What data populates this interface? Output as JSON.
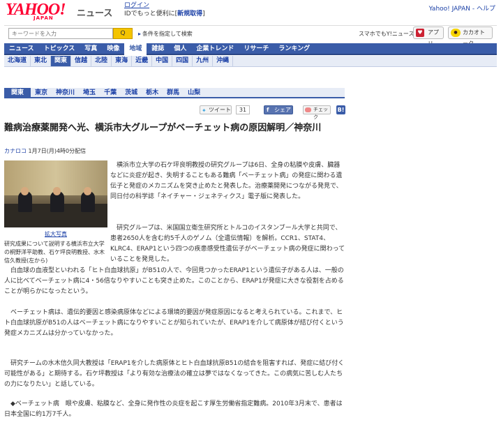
{
  "header": {
    "logo_text": "YAHOO!",
    "logo_sub": "JAPAN",
    "service": "ニュース",
    "login_link": "ログイン",
    "login_text": "IDでもっと便利に[",
    "new_register": "新規取得",
    "login_close": "]",
    "right_link": "Yahoo! JAPAN - ヘルプ"
  },
  "search": {
    "placeholder": "キーワードを入力",
    "button_icon": "search-icon",
    "button_label": "Q",
    "condition_link": "条件を指定して検索",
    "smartphone_label": "スマホでもY!ニュース",
    "app_label": "アプリ",
    "kakao_label": "カカオトーク"
  },
  "main_nav": [
    "ニュース",
    "トピックス",
    "写真",
    "映像",
    "地域",
    "雑誌",
    "個人",
    "企業トレンド",
    "リサーチ",
    "ランキング"
  ],
  "main_nav_active": "地域",
  "sub_nav": [
    "北海道",
    "東北",
    "関東",
    "信越",
    "北陸",
    "東海",
    "近畿",
    "中国",
    "四国",
    "九州",
    "沖縄"
  ],
  "sub_nav_active": "関東",
  "region_nav": [
    "関東",
    "東京",
    "神奈川",
    "埼玉",
    "千葉",
    "茨城",
    "栃木",
    "群馬",
    "山梨"
  ],
  "region_nav_active": "関東",
  "social": {
    "tweet_label": "ツイート",
    "tweet_count": "31",
    "share_label": "シェア",
    "check_label": "チェック",
    "hatena_label": "B!"
  },
  "article": {
    "title": "難病治療薬開発へ光、横浜市大グループがベーチェット病の原因解明／神奈川",
    "source": "カナロコ",
    "date": "1月7日(月)4時0分配信",
    "photo_link": "拡大写真",
    "photo_caption": "研究成果について説明する横浜市立大学の桐野洋平助教、石ケ坪良明教授、水木信久教授(左から)",
    "lead": "横浜市立大学の石ケ坪良明教授の研究グループは6日、全身の粘膜や皮膚、臓器などに炎症が起き、失明することもある難病「ベーチェット病」の発症に関わる遺伝子と発症のメカニズムを突き止めたと発表した。治療薬開発につながる発見で、同日付の科学誌「ネイチャー・ジェネティクス」電子版に発表した。",
    "para2": "研究グループは、米国国立衛生研究所とトルコのイスタンブール大学と共同で、患者2650人を含む約5千人のゲノム（全遺伝情報）を解析。CCR1、STAT4、KLRC4、ERAP1という四つの疾患感受性遺伝子がベーチェット病の発症に関わっていることを発見した。",
    "para3": "白血球の血液型といわれる「ヒト白血球抗原」がB51の人で、今回見つかったERAP1という遺伝子がある人は、一般の人に比べてベーチェット病に4・56倍なりやすいことも突き止めた。このことから、ERAP1が発症に大きな役割を占めることが明らかになったという。",
    "para4": "ベーチェット病は、遺伝的要因と感染病原体などによる環境的要因が発症原因になると考えられている。これまで、ヒト白血球抗原がB51の人はベーチェット病になりやすいことが知られていたが、ERAP1を介して病原体が結び付くという発症メカニズムは分かっていなかった。",
    "para5": "研究チームの水木信久同大教授は「ERAP1を介した病原体とヒト白血球抗原B51の結合を阻害すれば、発症に結び付く可能性がある」と期待する。石ケ坪教授は「より有効な治療法の確立は夢ではなくなってきた。この病気に苦しむ人たちの力になりたい」と話している。",
    "para6": "◆ベーチェット病　眼や皮膚、粘膜など、全身に発作性の炎症を起こす厚生労働省指定難病。2010年3月末で、患者は日本全国に約1万7千人。"
  },
  "colors": {
    "brand_red": "#ff0033",
    "nav_blue": "#3a5ca8",
    "link_blue": "#1a3fa6",
    "search_yellow": "#f4c400"
  }
}
